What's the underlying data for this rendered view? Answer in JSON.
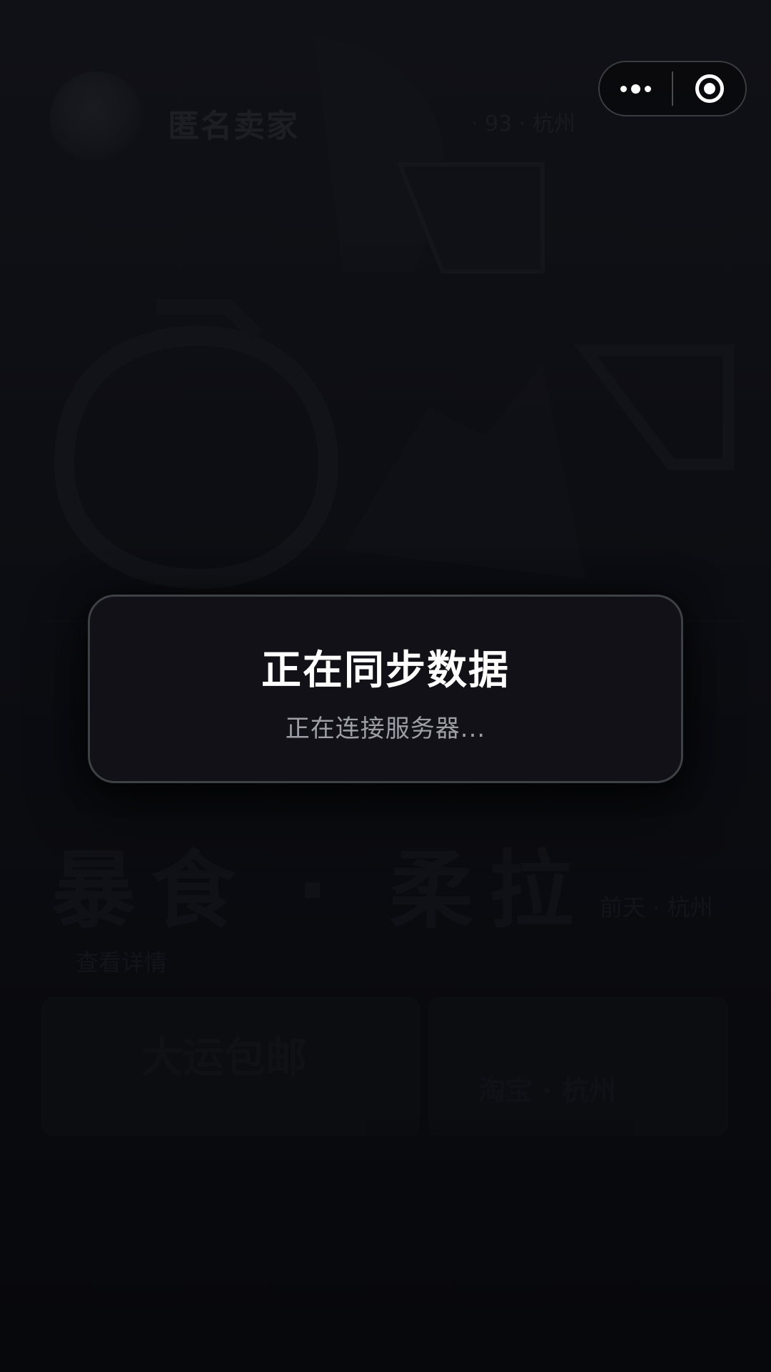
{
  "background": {
    "seller_name": "匿名卖家",
    "location": "· 93 · 杭州",
    "title": "暴食 · 柔拉",
    "subtitle": "前天 · 杭州",
    "detail_link": "查看详情",
    "card_left_text": "大运包邮",
    "card_right_text": "淘宝 · 杭州"
  },
  "capsule": {
    "more_icon": "more-dots-icon",
    "close_icon": "close-circle-icon"
  },
  "dialog": {
    "title": "正在同步数据",
    "message": "正在连接服务器..."
  },
  "colors": {
    "background": "#0b0c10",
    "dialog_bg": "#111117",
    "dialog_border": "#3f4046",
    "title": "#ffffff",
    "message": "#9e9ea6"
  }
}
